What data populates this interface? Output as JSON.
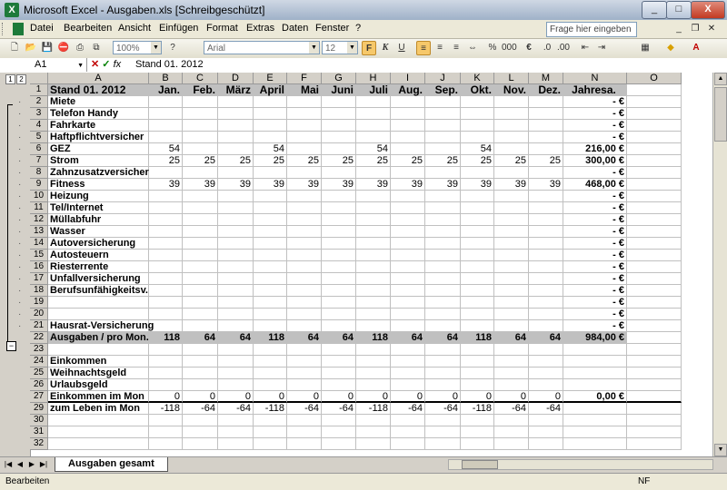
{
  "window": {
    "title": "Microsoft Excel - Ausgaben.xls  [Schreibgeschützt]",
    "app_icon": "X",
    "minimize": "_",
    "maximize": "□",
    "close": "X"
  },
  "menu": [
    "Datei",
    "Bearbeiten",
    "Ansicht",
    "Einfügen",
    "Format",
    "Extras",
    "Daten",
    "Fenster",
    "?"
  ],
  "help_box": "Frage hier eingeben",
  "toolbar": {
    "zoom": "100%",
    "font": "Arial",
    "size": "12",
    "bold": "F",
    "italic": "K",
    "underline": "U",
    "euro": "€"
  },
  "formula_bar": {
    "name_box": "A1",
    "fx": "fx",
    "content": "Stand 01. 2012"
  },
  "outline": {
    "levels": [
      "1",
      "2"
    ]
  },
  "columns": [
    "A",
    "B",
    "C",
    "D",
    "E",
    "F",
    "G",
    "H",
    "I",
    "J",
    "K",
    "L",
    "M",
    "N",
    "O"
  ],
  "rows": [
    {
      "n": "1",
      "kind": "hdr",
      "a": "Stand 01. 2012",
      "m": [
        "Jan.",
        "Feb.",
        "März",
        "April",
        "Mai",
        "Juni",
        "Juli",
        "Aug.",
        "Sep.",
        "Okt.",
        "Nov.",
        "Dez."
      ],
      "total": "Jahresa."
    },
    {
      "n": "2",
      "a": "Miete",
      "m": [
        "",
        "",
        "",
        "",
        "",
        "",
        "",
        "",
        "",
        "",
        "",
        ""
      ],
      "total": "-   €"
    },
    {
      "n": "3",
      "a": "Telefon Handy",
      "m": [
        "",
        "",
        "",
        "",
        "",
        "",
        "",
        "",
        "",
        "",
        "",
        ""
      ],
      "total": "-   €"
    },
    {
      "n": "4",
      "a": "Fahrkarte",
      "m": [
        "",
        "",
        "",
        "",
        "",
        "",
        "",
        "",
        "",
        "",
        "",
        ""
      ],
      "total": "-   €"
    },
    {
      "n": "5",
      "a": "Haftpflichtversicher",
      "m": [
        "",
        "",
        "",
        "",
        "",
        "",
        "",
        "",
        "",
        "",
        "",
        ""
      ],
      "total": "-   €"
    },
    {
      "n": "6",
      "a": "GEZ",
      "m": [
        "54",
        "",
        "",
        "54",
        "",
        "",
        "54",
        "",
        "",
        "54",
        "",
        ""
      ],
      "total": "216,00 €"
    },
    {
      "n": "7",
      "a": "Strom",
      "m": [
        "25",
        "25",
        "25",
        "25",
        "25",
        "25",
        "25",
        "25",
        "25",
        "25",
        "25",
        "25"
      ],
      "total": "300,00 €"
    },
    {
      "n": "8",
      "a": "Zahnzusatzversicher",
      "m": [
        "",
        "",
        "",
        "",
        "",
        "",
        "",
        "",
        "",
        "",
        "",
        ""
      ],
      "total": "-   €"
    },
    {
      "n": "9",
      "a": "Fitness",
      "m": [
        "39",
        "39",
        "39",
        "39",
        "39",
        "39",
        "39",
        "39",
        "39",
        "39",
        "39",
        "39"
      ],
      "total": "468,00 €"
    },
    {
      "n": "10",
      "a": "Heizung",
      "m": [
        "",
        "",
        "",
        "",
        "",
        "",
        "",
        "",
        "",
        "",
        "",
        ""
      ],
      "total": "-   €"
    },
    {
      "n": "11",
      "a": "Tel/Internet",
      "m": [
        "",
        "",
        "",
        "",
        "",
        "",
        "",
        "",
        "",
        "",
        "",
        ""
      ],
      "total": "-   €"
    },
    {
      "n": "12",
      "a": "Müllabfuhr",
      "m": [
        "",
        "",
        "",
        "",
        "",
        "",
        "",
        "",
        "",
        "",
        "",
        ""
      ],
      "total": "-   €"
    },
    {
      "n": "13",
      "a": "Wasser",
      "m": [
        "",
        "",
        "",
        "",
        "",
        "",
        "",
        "",
        "",
        "",
        "",
        ""
      ],
      "total": "-   €"
    },
    {
      "n": "14",
      "a": "Autoversicherung",
      "m": [
        "",
        "",
        "",
        "",
        "",
        "",
        "",
        "",
        "",
        "",
        "",
        ""
      ],
      "total": "-   €"
    },
    {
      "n": "15",
      "a": "Autosteuern",
      "m": [
        "",
        "",
        "",
        "",
        "",
        "",
        "",
        "",
        "",
        "",
        "",
        ""
      ],
      "total": "-   €"
    },
    {
      "n": "16",
      "a": "Riesterrente",
      "m": [
        "",
        "",
        "",
        "",
        "",
        "",
        "",
        "",
        "",
        "",
        "",
        ""
      ],
      "total": "-   €"
    },
    {
      "n": "17",
      "a": "Unfallversicherung",
      "m": [
        "",
        "",
        "",
        "",
        "",
        "",
        "",
        "",
        "",
        "",
        "",
        ""
      ],
      "total": "-   €"
    },
    {
      "n": "18",
      "a": "Berufsunfähigkeitsv.",
      "m": [
        "",
        "",
        "",
        "",
        "",
        "",
        "",
        "",
        "",
        "",
        "",
        ""
      ],
      "total": "-   €"
    },
    {
      "n": "19",
      "a": "",
      "m": [
        "",
        "",
        "",
        "",
        "",
        "",
        "",
        "",
        "",
        "",
        "",
        ""
      ],
      "total": "-   €"
    },
    {
      "n": "20",
      "a": "",
      "m": [
        "",
        "",
        "",
        "",
        "",
        "",
        "",
        "",
        "",
        "",
        "",
        ""
      ],
      "total": "-   €"
    },
    {
      "n": "21",
      "a": "Hausrat-Versicherung",
      "m": [
        "",
        "",
        "",
        "",
        "",
        "",
        "",
        "",
        "",
        "",
        "",
        ""
      ],
      "total": "-   €"
    },
    {
      "n": "22",
      "kind": "grey",
      "a": "Ausgaben / pro Mon.",
      "m": [
        "118",
        "64",
        "64",
        "118",
        "64",
        "64",
        "118",
        "64",
        "64",
        "118",
        "64",
        "64"
      ],
      "total": "984,00 €"
    },
    {
      "n": "23",
      "a": "",
      "m": [
        "",
        "",
        "",
        "",
        "",
        "",
        "",
        "",
        "",
        "",
        "",
        ""
      ],
      "total": ""
    },
    {
      "n": "24",
      "a": "Einkommen",
      "m": [
        "",
        "",
        "",
        "",
        "",
        "",
        "",
        "",
        "",
        "",
        "",
        ""
      ],
      "total": ""
    },
    {
      "n": "25",
      "a": "Weihnachtsgeld",
      "m": [
        "",
        "",
        "",
        "",
        "",
        "",
        "",
        "",
        "",
        "",
        "",
        ""
      ],
      "total": ""
    },
    {
      "n": "26",
      "a": "Urlaubsgeld",
      "m": [
        "",
        "",
        "",
        "",
        "",
        "",
        "",
        "",
        "",
        "",
        "",
        ""
      ],
      "total": ""
    },
    {
      "n": "27",
      "kind": "income",
      "a": "Einkommen im Mon",
      "m": [
        "0",
        "0",
        "0",
        "0",
        "0",
        "0",
        "0",
        "0",
        "0",
        "0",
        "0",
        "0"
      ],
      "total": "0,00 €"
    },
    {
      "n": "29",
      "a": "zum Leben im Mon",
      "m": [
        "-118",
        "-64",
        "-64",
        "-118",
        "-64",
        "-64",
        "-118",
        "-64",
        "-64",
        "-118",
        "-64",
        "-64"
      ],
      "total": ""
    },
    {
      "n": "30",
      "a": "",
      "m": [
        "",
        "",
        "",
        "",
        "",
        "",
        "",
        "",
        "",
        "",
        "",
        ""
      ],
      "total": ""
    },
    {
      "n": "31",
      "a": "",
      "m": [
        "",
        "",
        "",
        "",
        "",
        "",
        "",
        "",
        "",
        "",
        "",
        ""
      ],
      "total": ""
    },
    {
      "n": "32",
      "a": "",
      "m": [
        "",
        "",
        "",
        "",
        "",
        "",
        "",
        "",
        "",
        "",
        "",
        ""
      ],
      "total": ""
    }
  ],
  "sheet_tab": "Ausgaben gesamt",
  "status": {
    "mode": "Bearbeiten",
    "nf": "NF"
  }
}
